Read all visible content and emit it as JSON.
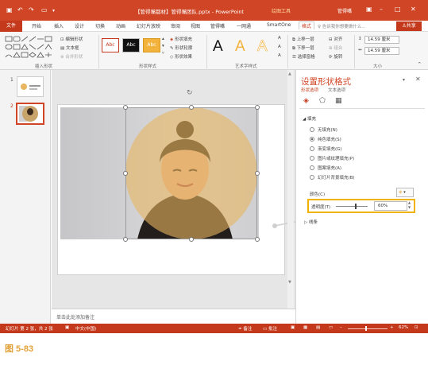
{
  "window": {
    "document_title": "【管得嘴都材】管得嘴团队.pptx - PowerPoint",
    "context_tab_label": "绘图工具",
    "username": "管得嘴",
    "quick_access": [
      "save-icon",
      "undo-icon",
      "redo-icon",
      "start-slideshow-icon"
    ],
    "accent_color": "#d04525"
  },
  "ribbon_tabs": {
    "file": "文件",
    "items": [
      "开始",
      "插入",
      "设计",
      "切换",
      "动画",
      "幻灯片放映",
      "审阅",
      "视图",
      "管得嘴",
      "一网通",
      "SmartOne"
    ],
    "format": "格式",
    "tell_me": "告诉我你想要做什么...",
    "share": "共享"
  },
  "ribbon": {
    "insert_shapes": {
      "edit_shape": "编辑形状",
      "text_box": "文本框",
      "merge_shapes": "合并形状",
      "label": "插入形状"
    },
    "shape_styles": {
      "abc_label": "Abc",
      "fill": "形状填充",
      "outline": "形状轮廓",
      "effects": "形状效果",
      "label": "形状样式"
    },
    "wordart": {
      "label": "艺术字样式"
    },
    "arrange": {
      "bring_forward": "上移一层",
      "send_backward": "下移一层",
      "selection_pane": "选择窗格",
      "align": "对齐",
      "group": "组合",
      "rotate": "旋转"
    },
    "size": {
      "height": "14.59 厘米",
      "width": "14.59 厘米",
      "label": "大小"
    }
  },
  "slides": {
    "numbers": [
      "1",
      "2"
    ],
    "selected": "2"
  },
  "notes": {
    "placeholder": "单击此处添加备注"
  },
  "format_pane": {
    "title": "设置形状格式",
    "subtabs": [
      "形状选项",
      "文本选项"
    ],
    "fill_section": "填充",
    "fill_options": [
      {
        "label": "无填充(N)",
        "selected": false
      },
      {
        "label": "纯色填充(S)",
        "selected": true
      },
      {
        "label": "渐变填充(G)",
        "selected": false
      },
      {
        "label": "图片或纹理填充(P)",
        "selected": false
      },
      {
        "label": "图案填充(A)",
        "selected": false
      },
      {
        "label": "幻灯片背景填充(B)",
        "selected": false
      }
    ],
    "color_label": "颜色(C)",
    "transparency_label": "透明度(T)",
    "transparency_value": "60%",
    "transparency_level": 60,
    "line_section": "线条",
    "fill_color": "#e8b660",
    "highlight_color": "#f0b400"
  },
  "status": {
    "slide_info": "幻灯片 第 2 张，共 2 张",
    "language": "中文(中国)",
    "notes_btn": "备注",
    "comments_btn": "批注",
    "zoom": "62%"
  },
  "caption": "图 5-83"
}
